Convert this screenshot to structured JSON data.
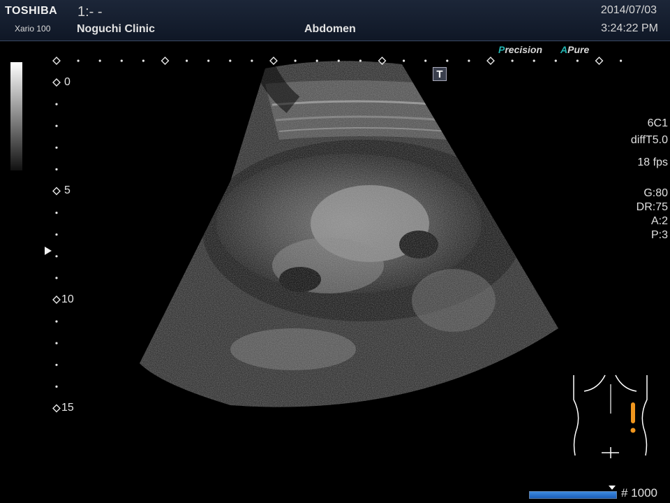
{
  "header": {
    "brand": "TOSHIBA",
    "model": "Xario 100",
    "patient_id": "1:- -",
    "clinic": "Noguchi Clinic",
    "exam": "Abdomen",
    "date": "2014/07/03",
    "time": "3:24:22 PM"
  },
  "badges": {
    "precision_initial": "P",
    "precision_rest": "recision",
    "apure_initial": "A",
    "apure_rest": "Pure",
    "accent_color": "#22b3b0"
  },
  "trackball_button": "T",
  "depth_scale": {
    "labels": [
      "0",
      "5",
      "10",
      "15"
    ],
    "unit_marks_per_label": 5
  },
  "params": {
    "probe": "6C1",
    "preset": "diffT5.0",
    "frame_rate": "18 fps",
    "gain": "G:80",
    "dynamic_range": "DR:75",
    "a_value": "A:2",
    "p_value": "P:3"
  },
  "body_mark": {
    "indicator_color": "#f0961e",
    "icon": "abdomen-bodymark-icon"
  },
  "cine": {
    "frame_label": "# 1000",
    "progress": 0.93
  }
}
